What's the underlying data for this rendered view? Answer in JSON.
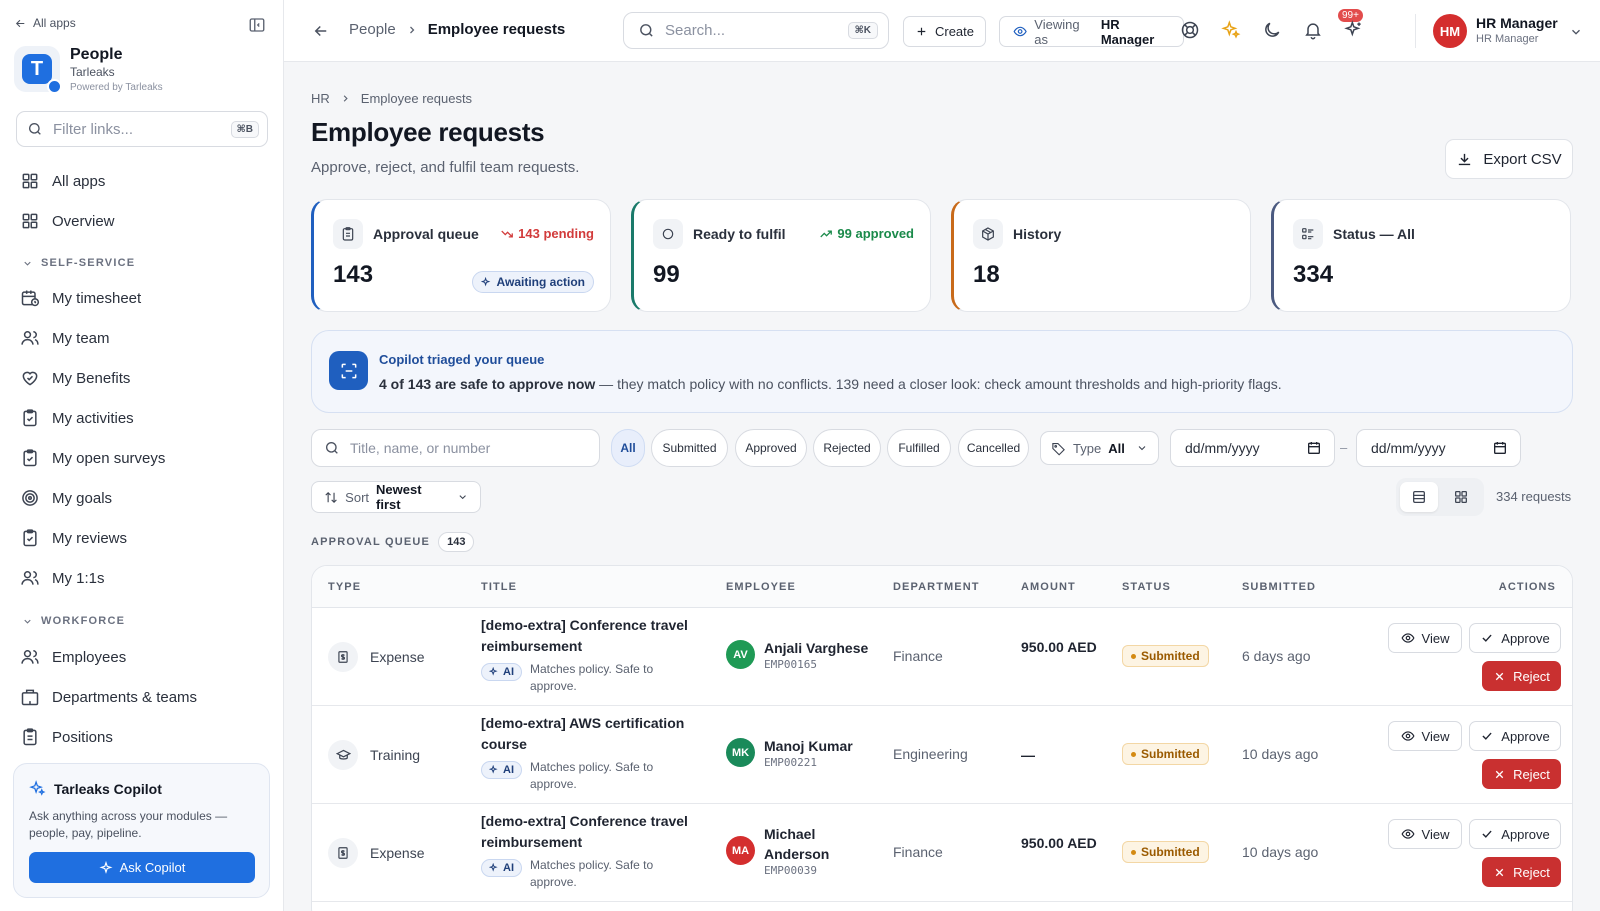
{
  "sidebar": {
    "all_apps_link": "All apps",
    "brand": {
      "name": "People",
      "org": "Tarleaks",
      "powered": "Powered by Tarleaks",
      "logo_letter": "T"
    },
    "filter": {
      "placeholder": "Filter links...",
      "shortcut": "⌘B"
    },
    "top_items": [
      {
        "label": "All apps",
        "icon": "grid-icon"
      },
      {
        "label": "Overview",
        "icon": "grid-icon"
      }
    ],
    "self_service_label": "SELF-SERVICE",
    "self_service_items": [
      {
        "label": "My timesheet",
        "icon": "calendar-clock-icon"
      },
      {
        "label": "My team",
        "icon": "users-icon"
      },
      {
        "label": "My Benefits",
        "icon": "heart-handshake-icon"
      },
      {
        "label": "My activities",
        "icon": "clipboard-check-icon"
      },
      {
        "label": "My open surveys",
        "icon": "clipboard-check-icon"
      },
      {
        "label": "My goals",
        "icon": "target-icon"
      },
      {
        "label": "My reviews",
        "icon": "clipboard-check-icon"
      },
      {
        "label": "My 1:1s",
        "icon": "users-icon"
      }
    ],
    "workforce_label": "WORKFORCE",
    "workforce_items": [
      {
        "label": "Employees",
        "icon": "users-icon"
      },
      {
        "label": "Departments & teams",
        "icon": "building-icon"
      },
      {
        "label": "Positions",
        "icon": "clipboard-icon"
      }
    ],
    "copilot": {
      "title": "Tarleaks Copilot",
      "description": "Ask anything across your modules — people, pay, pipeline.",
      "button": "Ask Copilot"
    }
  },
  "topbar": {
    "breadcrumb": [
      "People",
      "Employee requests"
    ],
    "search": {
      "placeholder": "Search...",
      "shortcut": "⌘K"
    },
    "create_label": "Create",
    "viewing_prefix": "Viewing as",
    "viewing_role": "HR Manager",
    "notification_count": "99+",
    "user": {
      "initials": "HM",
      "name": "HR Manager",
      "role": "HR Manager"
    }
  },
  "page": {
    "breadcrumb": [
      "HR",
      "Employee requests"
    ],
    "title": "Employee requests",
    "subtitle": "Approve, reject, and fulfil team requests.",
    "export_label": "Export CSV"
  },
  "stats": [
    {
      "label": "Approval queue",
      "value": "143",
      "trend": "143 pending",
      "trend_color": "#d23b3b",
      "chip": "Awaiting action",
      "accent": "#1f5fbf"
    },
    {
      "label": "Ready to fulfil",
      "value": "99",
      "trend": "99 approved",
      "trend_color": "#1a8a4a",
      "accent": "#1a7a6a"
    },
    {
      "label": "History",
      "value": "18",
      "accent": "#c86a1a"
    },
    {
      "label": "Status — All",
      "value": "334",
      "accent": "#4b5a80"
    }
  ],
  "banner": {
    "title": "Copilot triaged your queue",
    "bold": "4 of 143 are safe to approve now",
    "rest": " — they match policy with no conflicts. 139 need a closer look: check amount thresholds and high-priority flags."
  },
  "filters": {
    "search_placeholder": "Title, name, or number",
    "pills": [
      "All",
      "Submitted",
      "Approved",
      "Rejected",
      "Fulfilled",
      "Cancelled"
    ],
    "active_pill": "All",
    "type_label": "Type",
    "type_value": "All",
    "date_from": "dd/mm/yyyy",
    "date_to": "dd/mm/yyyy",
    "date_separator": "–",
    "sort_label": "Sort",
    "sort_value": "Newest first",
    "count_text": "334 requests"
  },
  "queue": {
    "label": "APPROVAL QUEUE",
    "count": "143"
  },
  "table": {
    "headers": [
      "TYPE",
      "TITLE",
      "EMPLOYEE",
      "DEPARTMENT",
      "AMOUNT",
      "STATUS",
      "SUBMITTED",
      "ACTIONS"
    ],
    "rows": [
      {
        "type": "Expense",
        "type_icon": "receipt-icon",
        "title": "[demo-extra] Conference travel reimbursement",
        "ai_label": "AI",
        "ai_note": "Matches policy. Safe to approve.",
        "initials": "AV",
        "avatar_color": "#1f9a55",
        "employee": "Anjali Varghese",
        "emp_id": "EMP00165",
        "department": "Finance",
        "amount": "950.00 AED",
        "status": "Submitted",
        "submitted": "6 days ago",
        "view": "View",
        "approve": "Approve",
        "reject": "Reject"
      },
      {
        "type": "Training",
        "type_icon": "graduation-cap-icon",
        "title": "[demo-extra] AWS certification course",
        "ai_label": "AI",
        "ai_note": "Matches policy. Safe to approve.",
        "initials": "MK",
        "avatar_color": "#1a8a5a",
        "employee": "Manoj Kumar",
        "emp_id": "EMP00221",
        "department": "Engineering",
        "amount": "—",
        "status": "Submitted",
        "submitted": "10 days ago",
        "view": "View",
        "approve": "Approve",
        "reject": "Reject"
      },
      {
        "type": "Expense",
        "type_icon": "receipt-icon",
        "title": "[demo-extra] Conference travel reimbursement",
        "ai_label": "AI",
        "ai_note": "Matches policy. Safe to approve.",
        "initials": "MA",
        "avatar_color": "#d42e2e",
        "employee": "Michael Anderson",
        "emp_id": "EMP00039",
        "department": "Finance",
        "amount": "950.00 AED",
        "status": "Submitted",
        "submitted": "10 days ago",
        "view": "View",
        "approve": "Approve",
        "reject": "Reject"
      }
    ]
  }
}
